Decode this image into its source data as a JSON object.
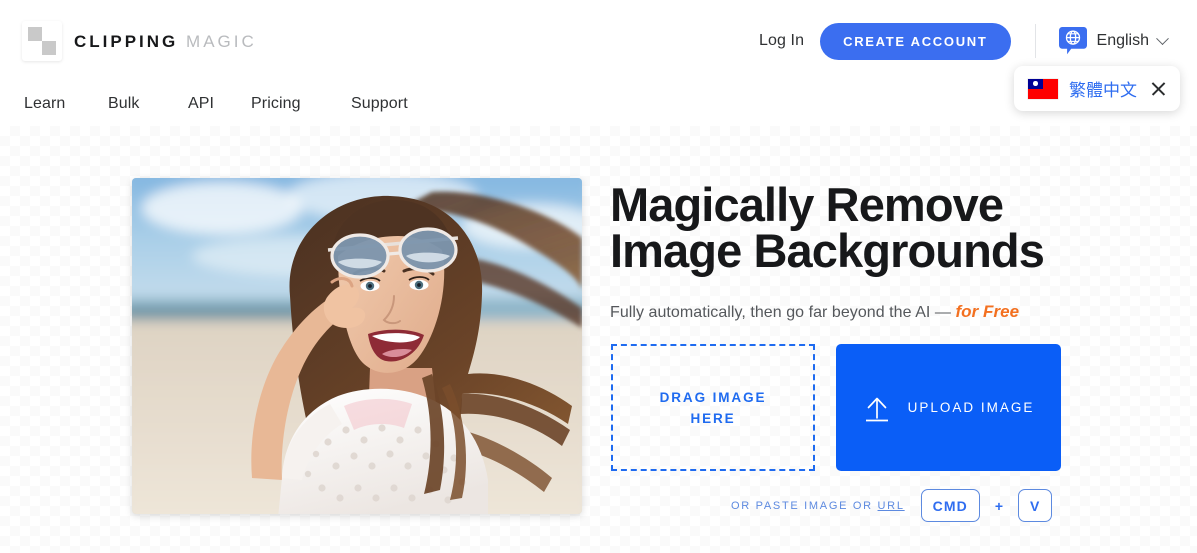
{
  "brand": {
    "name_bold": "CLIPPING",
    "name_light": "MAGIC",
    "logo_icon": "checkerboard-logo-icon"
  },
  "header": {
    "login_label": "Log In",
    "create_account_label": "CREATE ACCOUNT",
    "language_label": "English",
    "language_icon": "globe-speech-bubble-icon",
    "chevron_icon": "chevron-down-icon",
    "accent_blue": "#3b6ef0"
  },
  "language_popup": {
    "flag_icon": "taiwan-flag-icon",
    "label": "繁體中文",
    "close_icon": "close-icon",
    "link_color": "#2f6df0"
  },
  "nav": {
    "items": [
      {
        "label": "Learn"
      },
      {
        "label": "Bulk"
      },
      {
        "label": "API"
      },
      {
        "label": "Pricing"
      },
      {
        "label": "Support"
      }
    ]
  },
  "hero": {
    "heading_line1": "Magically Remove",
    "heading_line2": "Image Backgrounds",
    "subtitle_prefix": "Fully automatically, then go far beyond the AI — ",
    "subtitle_highlight": "for Free",
    "highlight_color": "#f37020",
    "photo_alt": "smiling-woman-on-beach-with-sunglasses"
  },
  "uploader": {
    "dropzone_label": "DRAG IMAGE HERE",
    "upload_button_label": "UPLOAD IMAGE",
    "upload_icon": "upload-arrow-icon",
    "upload_button_color": "#0a5ef7",
    "paste_text_prefix": "OR PASTE IMAGE OR ",
    "paste_text_link": "URL",
    "key_cmd": "CMD",
    "key_plus": "+",
    "key_v": "V"
  }
}
